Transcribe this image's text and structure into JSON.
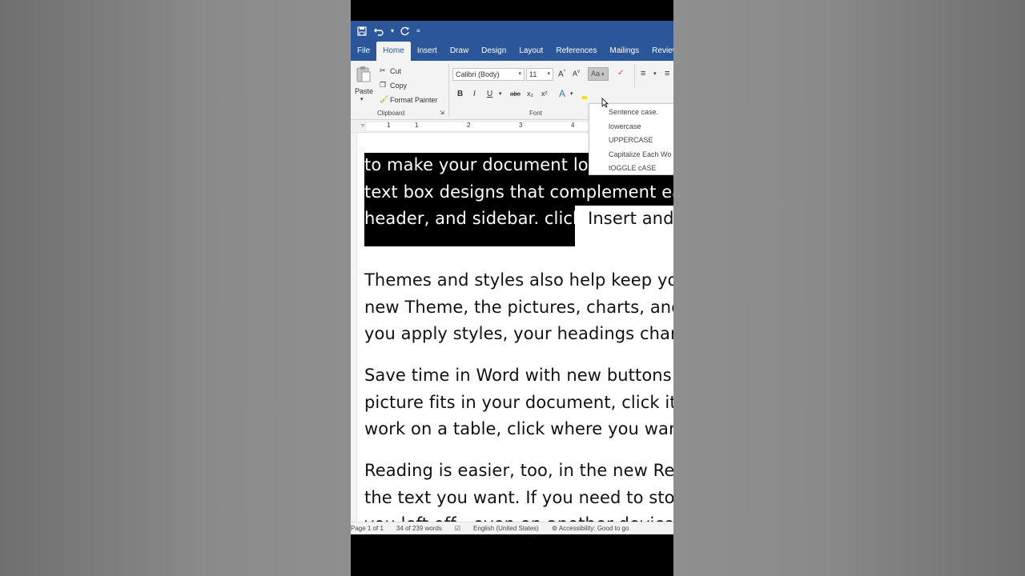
{
  "tabs": [
    "File",
    "Home",
    "Insert",
    "Draw",
    "Design",
    "Layout",
    "References",
    "Mailings",
    "Review"
  ],
  "active_tab": "Home",
  "clipboard": {
    "paste": "Paste",
    "cut": "Cut",
    "copy": "Copy",
    "format_painter": "Format Painter",
    "label": "Clipboard"
  },
  "font": {
    "name": "Calibri (Body)",
    "size": "11",
    "label": "Font",
    "bold": "B",
    "italic": "I",
    "underline": "U",
    "strike": "abc",
    "subscript": "x₂",
    "superscript": "x²",
    "change_case": "Aa"
  },
  "change_case_menu": [
    "Sentence case.",
    "lowercase",
    "UPPERCASE",
    "Capitalize Each Wo",
    "tOGGLE cASE"
  ],
  "ruler_numbers": [
    "1",
    "1",
    "2",
    "3",
    "4"
  ],
  "document": {
    "para1": [
      "to make your document look professio",
      "text box designs that complement eac",
      "header, and sidebar. click "
    ],
    "para1_tail": "Insert and th",
    "para2": [
      "Themes and styles also help keep you",
      "new Theme, the pictures, charts, and",
      "you apply styles, your headings chang"
    ],
    "para3": [
      "Save time in Word with new buttons t",
      "picture fits in your document, click it a",
      "work on a table, click where you want"
    ],
    "para4": [
      "Reading is easier, too, in the new Read",
      "the text you want. If you need to stop",
      "you left off - even on another device."
    ]
  },
  "status": {
    "page": "Page 1 of 1",
    "words": "34 of 239 words",
    "language": "English (United States)",
    "accessibility": "Accessibility: Good to go"
  }
}
